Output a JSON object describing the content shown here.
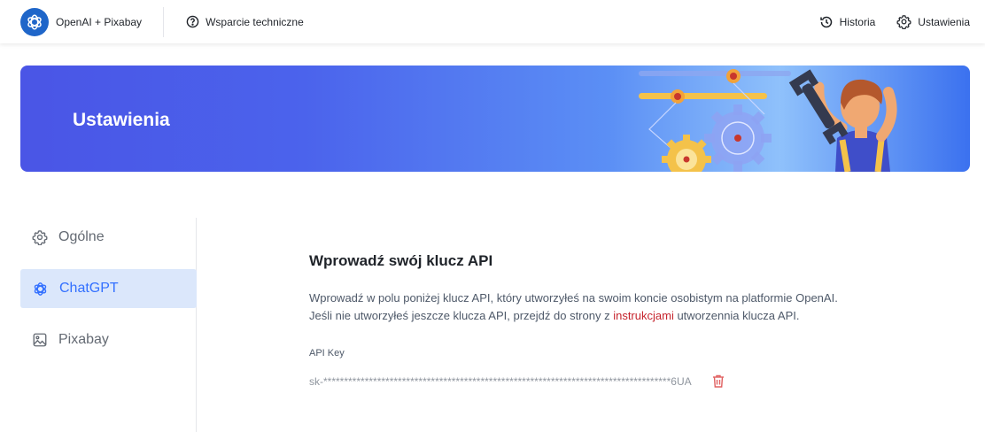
{
  "header": {
    "brand": "OpenAI + Pixabay",
    "support_label": "Wsparcie techniczne",
    "history_label": "Historia",
    "settings_label": "Ustawienia",
    "icons": {
      "logo": "openai-logo-icon",
      "support": "question-circle-icon",
      "history": "history-icon",
      "settings": "gear-icon"
    }
  },
  "banner": {
    "title": "Ustawienia",
    "illustration": "mechanic-with-wrench-and-gears"
  },
  "sidebar": {
    "items": [
      {
        "label": "Ogólne",
        "icon": "gear-icon",
        "active": false
      },
      {
        "label": "ChatGPT",
        "icon": "openai-icon",
        "active": true
      },
      {
        "label": "Pixabay",
        "icon": "image-icon",
        "active": false
      }
    ]
  },
  "main": {
    "heading": "Wprowadź swój klucz API",
    "desc_line1": "Wprowadź w polu poniżej klucz API, który utworzyłeś na swoim koncie osobistym na platformie OpenAI.",
    "desc_line2_before": "Jeśli nie utworzyłeś jeszcze klucza API, przejdź do strony z ",
    "desc_link": "instrukcjami",
    "desc_line2_after": " utworzennia klucza API.",
    "api_label": "API Key",
    "api_value": "sk-************************************************************************************6UA",
    "delete_icon": "trash-icon"
  },
  "colors": {
    "accent": "#3370ff",
    "active_bg": "#dbe7fb",
    "link": "#c6252e",
    "delete": "#e06060",
    "logo": "#1f66c9"
  }
}
